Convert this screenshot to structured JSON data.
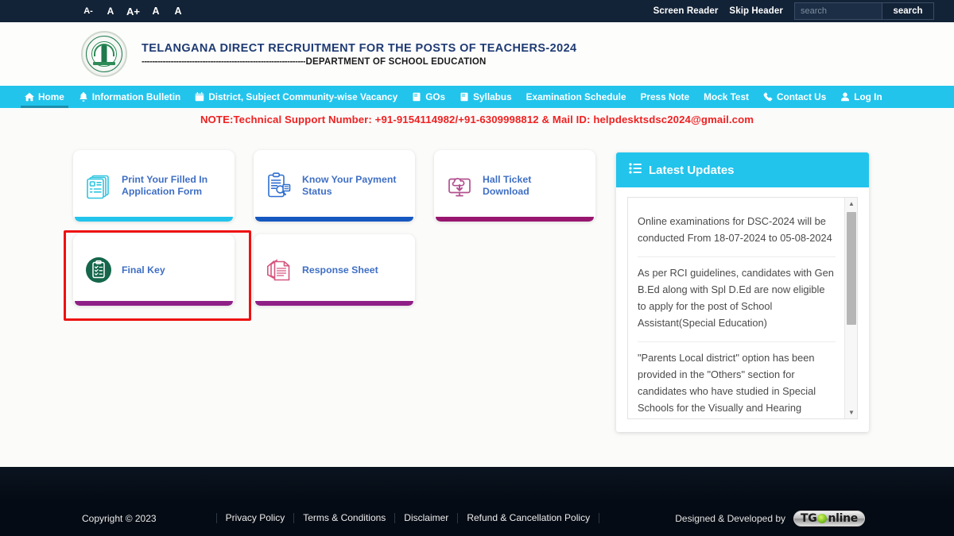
{
  "topbar": {
    "font_sizes": [
      "A-",
      "A",
      "A+",
      "A",
      "A"
    ],
    "screen_reader": "Screen Reader",
    "skip_header": "Skip Header",
    "search_placeholder": "search",
    "search_value": "",
    "search_button": "search"
  },
  "brand": {
    "title": "TELANGANA DIRECT RECRUITMENT FOR THE POSTS OF TEACHERS-2024",
    "dashes": "--------------------------------------------------------------",
    "subtitle": "DEPARTMENT OF SCHOOL EDUCATION",
    "emblem_alt": "telangana-government-emblem"
  },
  "nav": {
    "items": [
      {
        "label": "Home",
        "icon": "home-icon",
        "active": true
      },
      {
        "label": "Information Bulletin",
        "icon": "bell-icon",
        "active": false
      },
      {
        "label": "District, Subject Community-wise Vacancy",
        "icon": "calendar-icon",
        "active": false
      },
      {
        "label": "GOs",
        "icon": "book-icon",
        "active": false
      },
      {
        "label": "Syllabus",
        "icon": "book-icon",
        "active": false
      },
      {
        "label": "Examination Schedule",
        "icon": "",
        "active": false
      },
      {
        "label": "Press Note",
        "icon": "",
        "active": false
      },
      {
        "label": "Mock Test",
        "icon": "",
        "active": false
      },
      {
        "label": "Contact Us",
        "icon": "phone-icon",
        "active": false
      },
      {
        "label": "Log In",
        "icon": "user-icon",
        "active": false
      }
    ]
  },
  "note": {
    "text": "NOTE:Technical Support Number: +91-9154114982/+91-6309998812 & Mail ID: helpdesktsdsc2024@gmail.com",
    "color": "#ee2222"
  },
  "cards": [
    {
      "label": "Print Your Filled In Application Form",
      "icon": "document-list-icon",
      "accent": "#22c4ec",
      "icon_color": "#2ec5e0",
      "highlighted": false
    },
    {
      "label": "Know Your Payment Status",
      "icon": "clipboard-search-icon",
      "accent": "#1558c0",
      "icon_color": "#2f6fd0",
      "highlighted": false
    },
    {
      "label": "Hall Ticket Download",
      "icon": "monitor-download-icon",
      "accent": "#98166f",
      "icon_color": "#b2508f",
      "highlighted": false
    },
    {
      "label": "Final Key",
      "icon": "clipboard-check-circle-icon",
      "accent": "#8f1f86",
      "icon_color": "#15664a",
      "highlighted": true
    },
    {
      "label": "Response Sheet",
      "icon": "paper-stack-icon",
      "accent": "#8f1f86",
      "icon_color": "#d6557f",
      "highlighted": false
    }
  ],
  "updates": {
    "title": "Latest Updates",
    "icon": "list-icon",
    "items": [
      "Online examinations for DSC-2024 will be conducted From 18-07-2024 to 05-08-2024",
      "As per RCI guidelines, candidates with Gen B.Ed along with Spl D.Ed are now eligible to apply for the post of School Assistant(Special Education)",
      "\"Parents Local district\" option has been provided in the \"Others\" section for candidates who have studied in Special Schools for the Visually and Hearing Impaired in Hyderabad"
    ]
  },
  "footer": {
    "copyright": "Copyright © 2023",
    "links": [
      "Privacy Policy",
      "Terms & Conditions",
      "Disclaimer",
      "Refund & Cancellation Policy"
    ],
    "designed_by_label": "Designed & Developed by",
    "designed_by_brand_1": "TG",
    "designed_by_brand_2": "nline"
  }
}
